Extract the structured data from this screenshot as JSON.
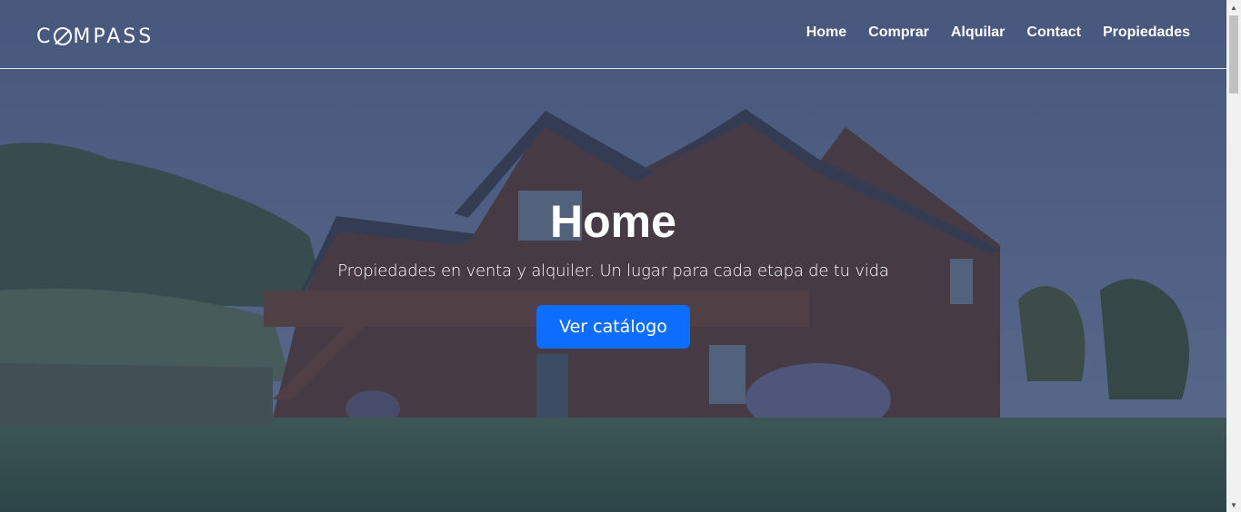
{
  "brand": {
    "logo_prefix": "C",
    "logo_suffix": "MPASS"
  },
  "nav": {
    "items": [
      {
        "label": "Home"
      },
      {
        "label": "Comprar"
      },
      {
        "label": "Alquilar"
      },
      {
        "label": "Contact"
      },
      {
        "label": "Propiedades"
      }
    ]
  },
  "hero": {
    "title": "Home",
    "subtitle": "Propiedades en venta y alquiler. Un lugar para cada etapa de tu vida",
    "cta_label": "Ver catálogo",
    "background": "house-photo"
  },
  "colors": {
    "accent": "#0d6efd",
    "header_text": "#ffffff"
  },
  "icons": {
    "scroll_up": "scroll-up-arrow-icon",
    "scroll_down": "scroll-down-arrow-icon"
  }
}
